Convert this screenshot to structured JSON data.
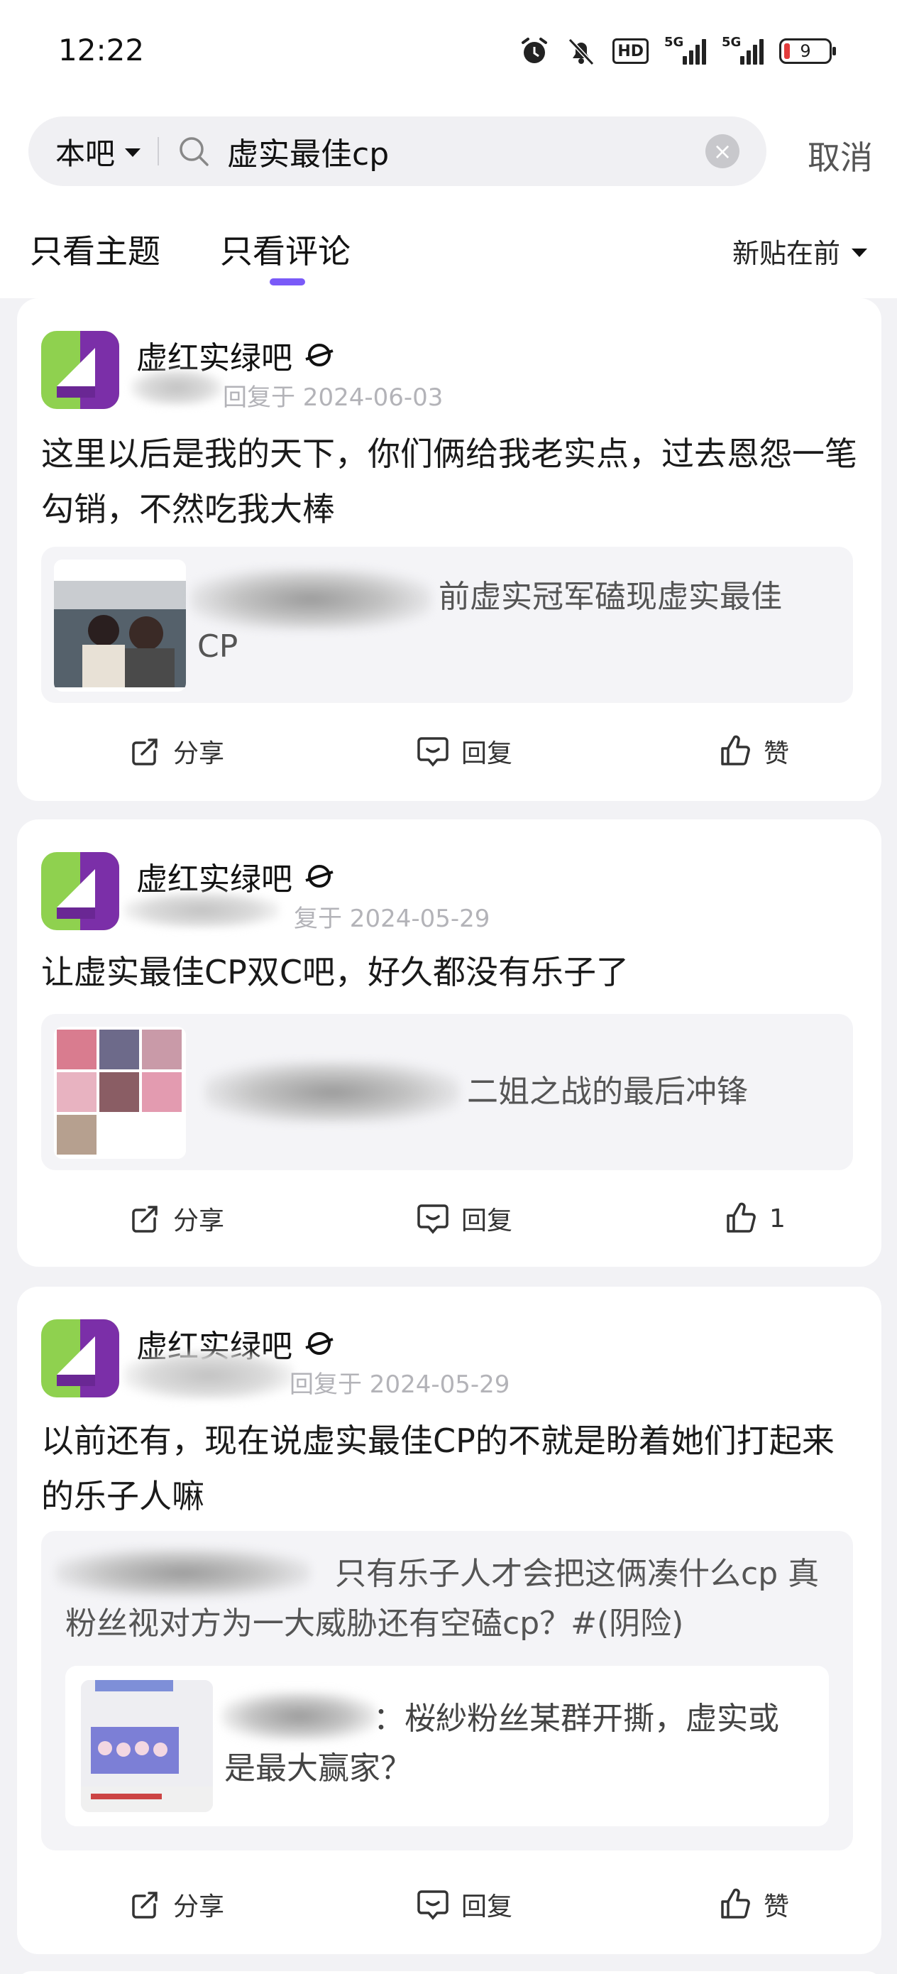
{
  "status_bar": {
    "time": "12:22",
    "hd_label": "HD",
    "signal1_label": "5G",
    "signal2_label": "5G",
    "battery": "9"
  },
  "search": {
    "scope": "本吧",
    "query": "虚实最佳cp",
    "cancel": "取消"
  },
  "tabs": {
    "topics": "只看主题",
    "comments": "只看评论",
    "active": "comments",
    "sort": "新贴在前"
  },
  "posts": [
    {
      "forum": "虚红实绿吧",
      "meta": "回复于 2024-06-03",
      "content": "这里以后是我的天下，你们俩给我老实点，过去恩怨一笔勾销，不然吃我大棒",
      "quote": "前虚实冠军磕现虚实最佳CP",
      "actions": {
        "share": "分享",
        "reply": "回复",
        "like": "赞"
      }
    },
    {
      "forum": "虚红实绿吧",
      "meta": "复于 2024-05-29",
      "content": "让虚实最佳CP双C吧，好久都没有乐子了",
      "quote": "二姐之战的最后冲锋",
      "actions": {
        "share": "分享",
        "reply": "回复",
        "like": "1"
      }
    },
    {
      "forum": "虚红实绿吧",
      "meta": "回复于 2024-05-29",
      "content": "以前还有，现在说虚实最佳CP的不就是盼着她们打起来的乐子人嘛",
      "quote": "只有乐子人才会把这俩凑什么cp 真粉丝视对方为一大威胁还有空磕cp？#(阴险)",
      "nested_quote": "：桜紗粉丝某群开撕，虚实或是最大赢家？",
      "actions": {
        "share": "分享",
        "reply": "回复",
        "like": "赞"
      }
    }
  ],
  "colors": {
    "accent": "#7a5af8",
    "avatar_green": "#8fd14f",
    "avatar_purple": "#7b2fa8"
  }
}
